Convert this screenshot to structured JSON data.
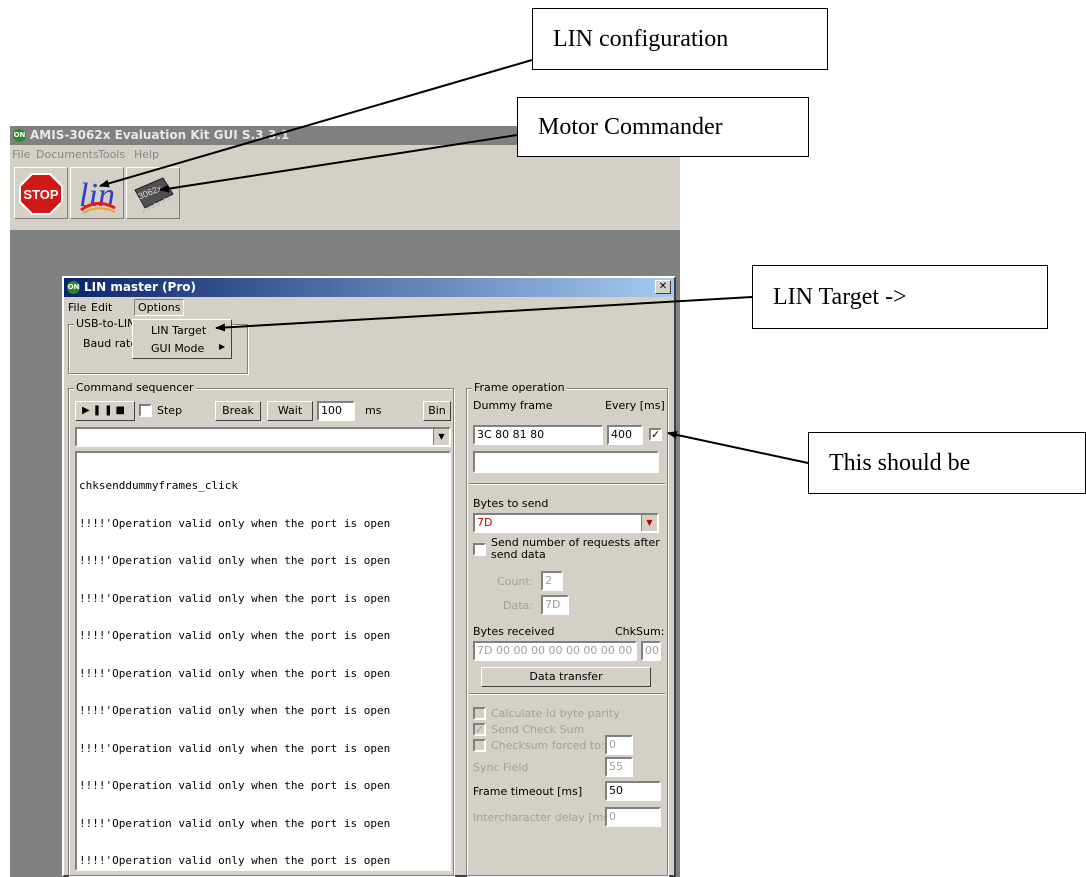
{
  "app": {
    "title": "AMIS-3062x Evaluation Kit GUI S.3.3.1",
    "menu": [
      "File",
      "Documents",
      "Tools",
      "Help"
    ],
    "toolbar": [
      {
        "name": "stop",
        "label": "STOP"
      },
      {
        "name": "lin",
        "label": "lin"
      },
      {
        "name": "motor",
        "label": "3062x"
      }
    ]
  },
  "dialog": {
    "title": "LIN master (Pro)",
    "close": "✕",
    "menu": [
      "File",
      "Edit",
      "Options"
    ],
    "usb_group": "USB-to-LIN",
    "baud_label": "Baud rate",
    "options_menu": [
      "LIN Target",
      "GUI Mode"
    ],
    "sequencer": {
      "title": "Command sequencer",
      "step": "Step",
      "break": "Break",
      "wait": "Wait",
      "wait_value": "100",
      "ms": "ms",
      "bin": "Bin",
      "log": [
        "chksenddummyframes_click",
        "!!!!'Operation valid only when the port is open",
        "!!!!'Operation valid only when the port is open",
        "!!!!'Operation valid only when the port is open",
        "!!!!'Operation valid only when the port is open",
        "!!!!'Operation valid only when the port is open",
        "!!!!'Operation valid only when the port is open",
        "!!!!'Operation valid only when the port is open",
        "!!!!'Operation valid only when the port is open",
        "!!!!'Operation valid only when the port is open",
        "!!!!'Operation valid only when the port is open"
      ]
    },
    "frame": {
      "title": "Frame operation",
      "dummy_label": "Dummy frame",
      "every_label": "Every [ms]",
      "dummy_value": "3C 80 81 80",
      "every_value": "400",
      "bytes_to_send": "Bytes to send",
      "send_value": "7D",
      "send_requests": "Send number of requests after send data",
      "count_label": "Count:",
      "count_value": "2",
      "data_label": "Data:",
      "data_value": "7D",
      "bytes_received": "Bytes received",
      "chksum_label": "ChkSum:",
      "received_value": "7D 00 00 00 00 00 00 00 00",
      "chksum_value": "00",
      "data_transfer": "Data transfer",
      "calc_parity": "Calculate Id byte parity",
      "send_checksum": "Send Check Sum",
      "checksum_forced": "Checksum forced to:",
      "checksum_forced_value": "0",
      "sync_label": "Sync Field",
      "sync_value": "55",
      "timeout_label": "Frame timeout [ms]",
      "timeout_value": "50",
      "interchar_label": "Intercharacter delay [ms]",
      "interchar_value": "0"
    }
  },
  "callouts": {
    "lin_config": "LIN configuration",
    "motor_commander": "Motor Commander",
    "lin_target": "LIN Target ->",
    "this_should_be": "This should be"
  }
}
